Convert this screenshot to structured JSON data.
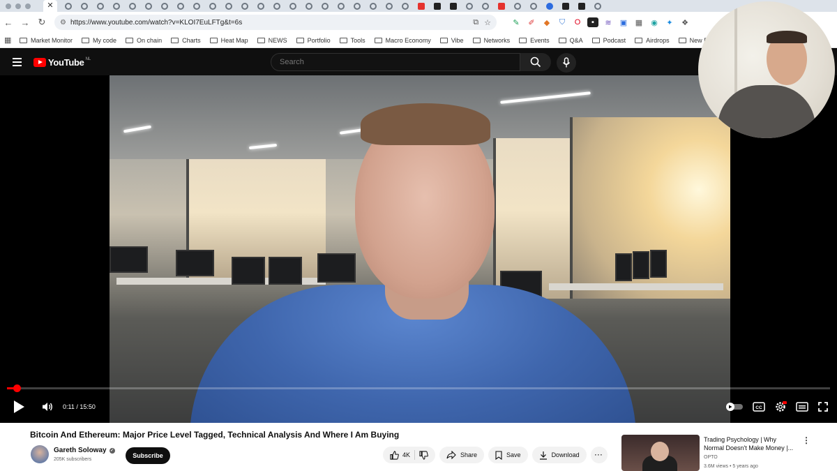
{
  "browser": {
    "url": "https://www.youtube.com/watch?v=KLOI7EuLFTg&t=6s",
    "bookmarks_apps_icon": "grid-icon",
    "bookmarks": [
      "Market Monitor",
      "My code",
      "On chain",
      "Charts",
      "Heat Map",
      "NEWS",
      "Portfolio",
      "Tools",
      "Macro Economy",
      "Vibe",
      "Networks",
      "Events",
      "Q&A",
      "Podcast",
      "Airdrops",
      "New Projects"
    ]
  },
  "youtube": {
    "logo_text": "YouTube",
    "logo_country": "NL",
    "search_placeholder": "Search"
  },
  "player": {
    "current_time": "0:11",
    "duration": "15:50",
    "time_separator": "/",
    "progress_fraction": 0.012,
    "accent_color": "#ff0000"
  },
  "video": {
    "title": "Bitcoin And Ethereum: Major Price Level Tagged, Technical Analysis And Where I Am Buying",
    "channel_name": "Gareth Soloway",
    "subscribers": "205K subscribers",
    "subscribe_label": "Subscribe",
    "likes": "4K",
    "share_label": "Share",
    "save_label": "Save",
    "download_label": "Download"
  },
  "recommended": {
    "title_line1": "Trading Psychology | Why",
    "title_line2": "Normal Doesn't Make Money |...",
    "channel": "OPTO",
    "meta": "3.6M views • 5 years ago"
  }
}
